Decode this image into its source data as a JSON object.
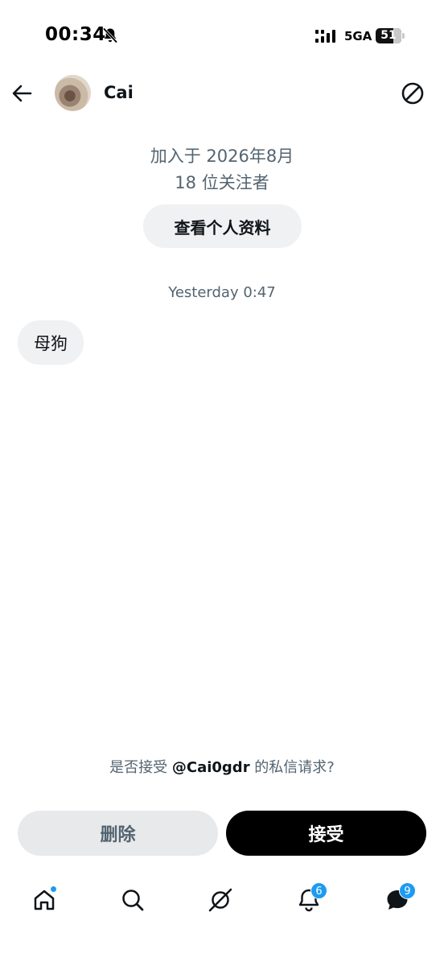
{
  "status_bar": {
    "time": "00:34",
    "network": "5GA",
    "battery": "51"
  },
  "header": {
    "name": "Cai"
  },
  "profile": {
    "joined": "加入于 2026年8月",
    "followers": "18 位关注者",
    "view_profile_label": "查看个人资料"
  },
  "conversation": {
    "timestamp": "Yesterday 0:47",
    "messages": [
      {
        "text": "母狗"
      }
    ]
  },
  "request": {
    "prefix": "是否接受 ",
    "handle": "@Cai0gdr",
    "suffix": " 的私信请求?",
    "delete_label": "删除",
    "accept_label": "接受"
  },
  "bottom_nav": {
    "items": [
      {
        "icon": "home-icon"
      },
      {
        "icon": "search-icon"
      },
      {
        "icon": "grok-icon"
      },
      {
        "icon": "bell-icon",
        "badge": "6"
      },
      {
        "icon": "messages-icon",
        "badge": "9"
      }
    ]
  },
  "colors": {
    "accent": "#1d9bf0",
    "secondary_text": "#536471",
    "button_bg": "#eff1f2"
  }
}
